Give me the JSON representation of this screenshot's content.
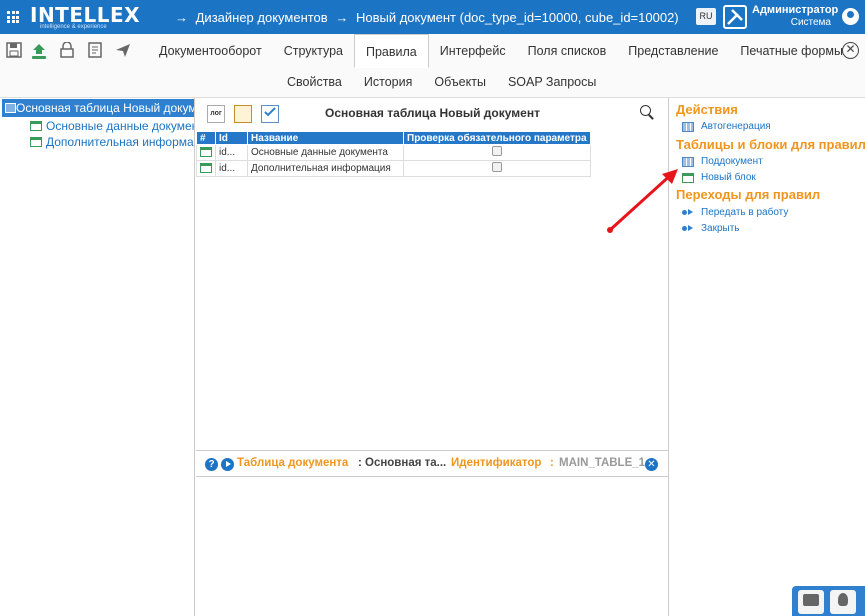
{
  "header": {
    "logo_text": "INTELLEX",
    "logo_subtitle": "intelligence & experience",
    "breadcrumbs": [
      "→",
      "Дизайнер документов",
      "→",
      "Новый документ (doc_type_id=10000, cube_id=10002)"
    ],
    "language": "RU",
    "user_name": "Администратор",
    "user_role": "Система"
  },
  "toolbar": {
    "icons": [
      "save-icon",
      "upload-icon",
      "lock-icon",
      "report-icon",
      "send-icon"
    ],
    "tabs": [
      "Документооборот",
      "Структура",
      "Правила",
      "Интерфейс",
      "Поля списков",
      "Представление",
      "Печатные формы"
    ],
    "active_tab": "Правила",
    "subtabs": [
      "Свойства",
      "История",
      "Объекты",
      "SOAP Запросы"
    ],
    "close_symbol": "✕"
  },
  "tree": {
    "root": "Основная таблица Новый документ",
    "children": [
      "Основные данные документа",
      "Дополнительная информация"
    ]
  },
  "center": {
    "tool_log_label": "лог",
    "title": "Основная таблица Новый документ",
    "columns": [
      "#",
      "Id",
      "Название",
      "Проверка обязательного параметра"
    ],
    "rows": [
      {
        "id": "id...",
        "name": "Основные данные документа",
        "checked": false
      },
      {
        "id": "id...",
        "name": "Дополнительная информация",
        "checked": false
      }
    ]
  },
  "bottom": {
    "help_symbol": "?",
    "label1": "Таблица документа",
    "sep1": ":",
    "value1": "Основная та...",
    "label2": "Идентификатор",
    "sep2": ":",
    "value2": "MAIN_TABLE_1",
    "close_symbol": "✕"
  },
  "right": {
    "sections": [
      {
        "title": "Действия",
        "items": [
          {
            "label": "Автогенерация",
            "icon": "grid-icon"
          }
        ]
      },
      {
        "title": "Таблицы и блоки для правил",
        "items": [
          {
            "label": "Поддокумент",
            "icon": "grid-icon"
          },
          {
            "label": "Новый блок",
            "icon": "block-icon"
          }
        ]
      },
      {
        "title": "Переходы для правил",
        "items": [
          {
            "label": "Передать в работу",
            "icon": "transition-icon"
          },
          {
            "label": "Закрыть",
            "icon": "transition-icon"
          }
        ]
      }
    ]
  },
  "colors": {
    "header_blue": "#1c74c4",
    "accent_orange": "#f0961e",
    "annotation_red": "#e8141c"
  }
}
